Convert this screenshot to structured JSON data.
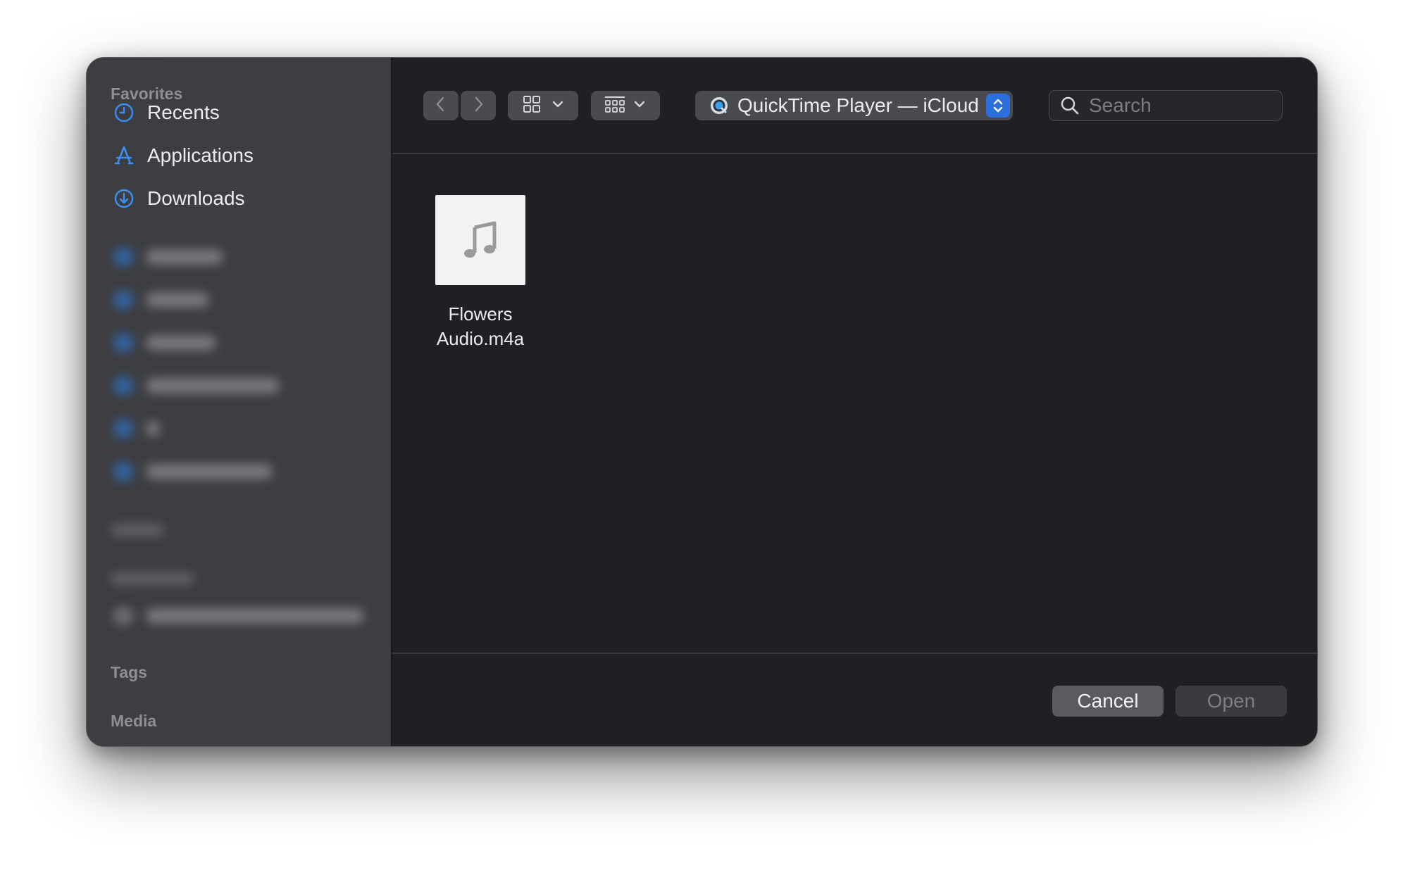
{
  "sidebar": {
    "favorites_heading": "Favorites",
    "items": [
      {
        "label": "Recents",
        "icon": "clock-icon"
      },
      {
        "label": "Applications",
        "icon": "applications-icon"
      },
      {
        "label": "Downloads",
        "icon": "download-icon"
      }
    ],
    "tags_heading": "Tags",
    "media_heading": "Media"
  },
  "toolbar": {
    "location": "QuickTime Player — iCloud",
    "search_placeholder": "Search"
  },
  "files": [
    {
      "name_line1": "Flowers",
      "name_line2": "Audio.m4a",
      "icon": "music-note-icon"
    }
  ],
  "footer": {
    "cancel_label": "Cancel",
    "open_label": "Open"
  },
  "colors": {
    "accent": "#2a6fdb",
    "sidebar_icon": "#3a8ff0"
  }
}
